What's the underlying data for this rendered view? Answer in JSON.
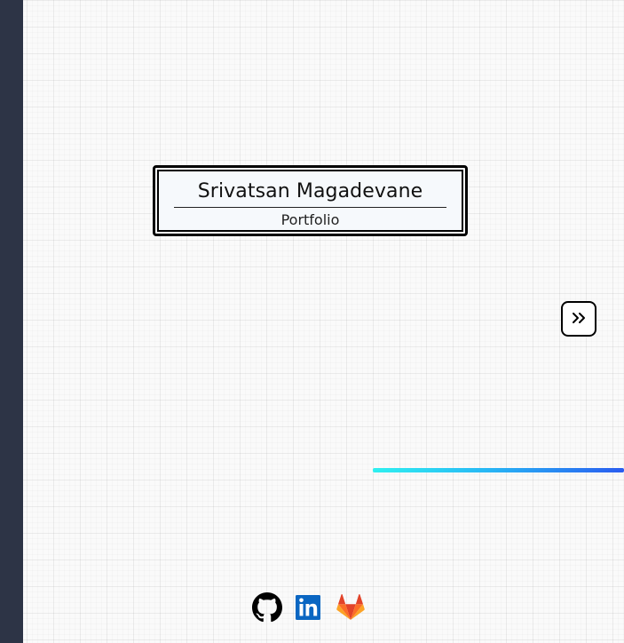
{
  "title_card": {
    "name": "Srivatsan Magadevane",
    "subtitle": "Portfolio"
  },
  "navigation": {
    "next_icon": "double-chevron-right-icon"
  },
  "socials": [
    {
      "name": "GitHub",
      "icon": "github-icon",
      "color": "#000000"
    },
    {
      "name": "LinkedIn",
      "icon": "linkedin-icon",
      "color": "#0a66c2"
    },
    {
      "name": "GitLab",
      "icon": "gitlab-icon",
      "color": "#fc6d26"
    }
  ],
  "colors": {
    "sidebar": "#2d3446",
    "background": "#fafafa",
    "accent_gradient_start": "#2ff0f0",
    "accent_gradient_end": "#2a5cf0"
  }
}
